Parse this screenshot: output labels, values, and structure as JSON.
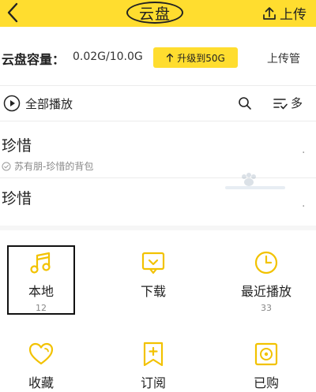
{
  "header": {
    "title": "云盘",
    "upload_label": "上传",
    "back_icon": "chevron-left-icon",
    "upload_icon": "upload-icon",
    "accent": "#ffdd2f"
  },
  "capacity": {
    "label": "云盘容量：",
    "value": "0.02G/10.0G",
    "upgrade_label": "升级到50G",
    "manage_label": "上传管"
  },
  "toolbar": {
    "play_all_label": "全部播放",
    "multi_label": "多"
  },
  "songs": [
    {
      "title": "珍惜",
      "subtitle": "苏有朋-珍惜的背包",
      "more": "."
    },
    {
      "title": "珍惜",
      "subtitle": "",
      "more": "."
    }
  ],
  "shortcuts": [
    {
      "label": "本地",
      "count": "12",
      "icon": "music-note-icon"
    },
    {
      "label": "下载",
      "count": "",
      "icon": "download-tray-icon"
    },
    {
      "label": "最近播放",
      "count": "33",
      "icon": "clock-icon"
    },
    {
      "label": "收藏",
      "count": "",
      "icon": "heart-icon"
    },
    {
      "label": "订阅",
      "count": "",
      "icon": "bookmark-plus-icon"
    },
    {
      "label": "已购",
      "count": "",
      "icon": "purchased-icon"
    }
  ]
}
